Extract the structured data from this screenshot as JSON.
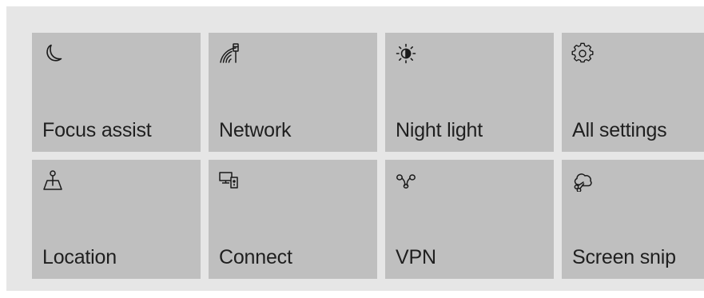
{
  "quick_actions": {
    "tiles": [
      {
        "label": "Focus assist",
        "icon": "moon-icon"
      },
      {
        "label": "Network",
        "icon": "network-icon"
      },
      {
        "label": "Night light",
        "icon": "brightness-icon"
      },
      {
        "label": "All settings",
        "icon": "gear-icon"
      },
      {
        "label": "Location",
        "icon": "location-icon"
      },
      {
        "label": "Connect",
        "icon": "connect-icon"
      },
      {
        "label": "VPN",
        "icon": "vpn-icon"
      },
      {
        "label": "Screen snip",
        "icon": "screen-snip-icon"
      }
    ]
  },
  "colors": {
    "panel_background": "#e6e6e6",
    "tile_background": "#bfbfbf",
    "text": "#1f1f1f"
  }
}
